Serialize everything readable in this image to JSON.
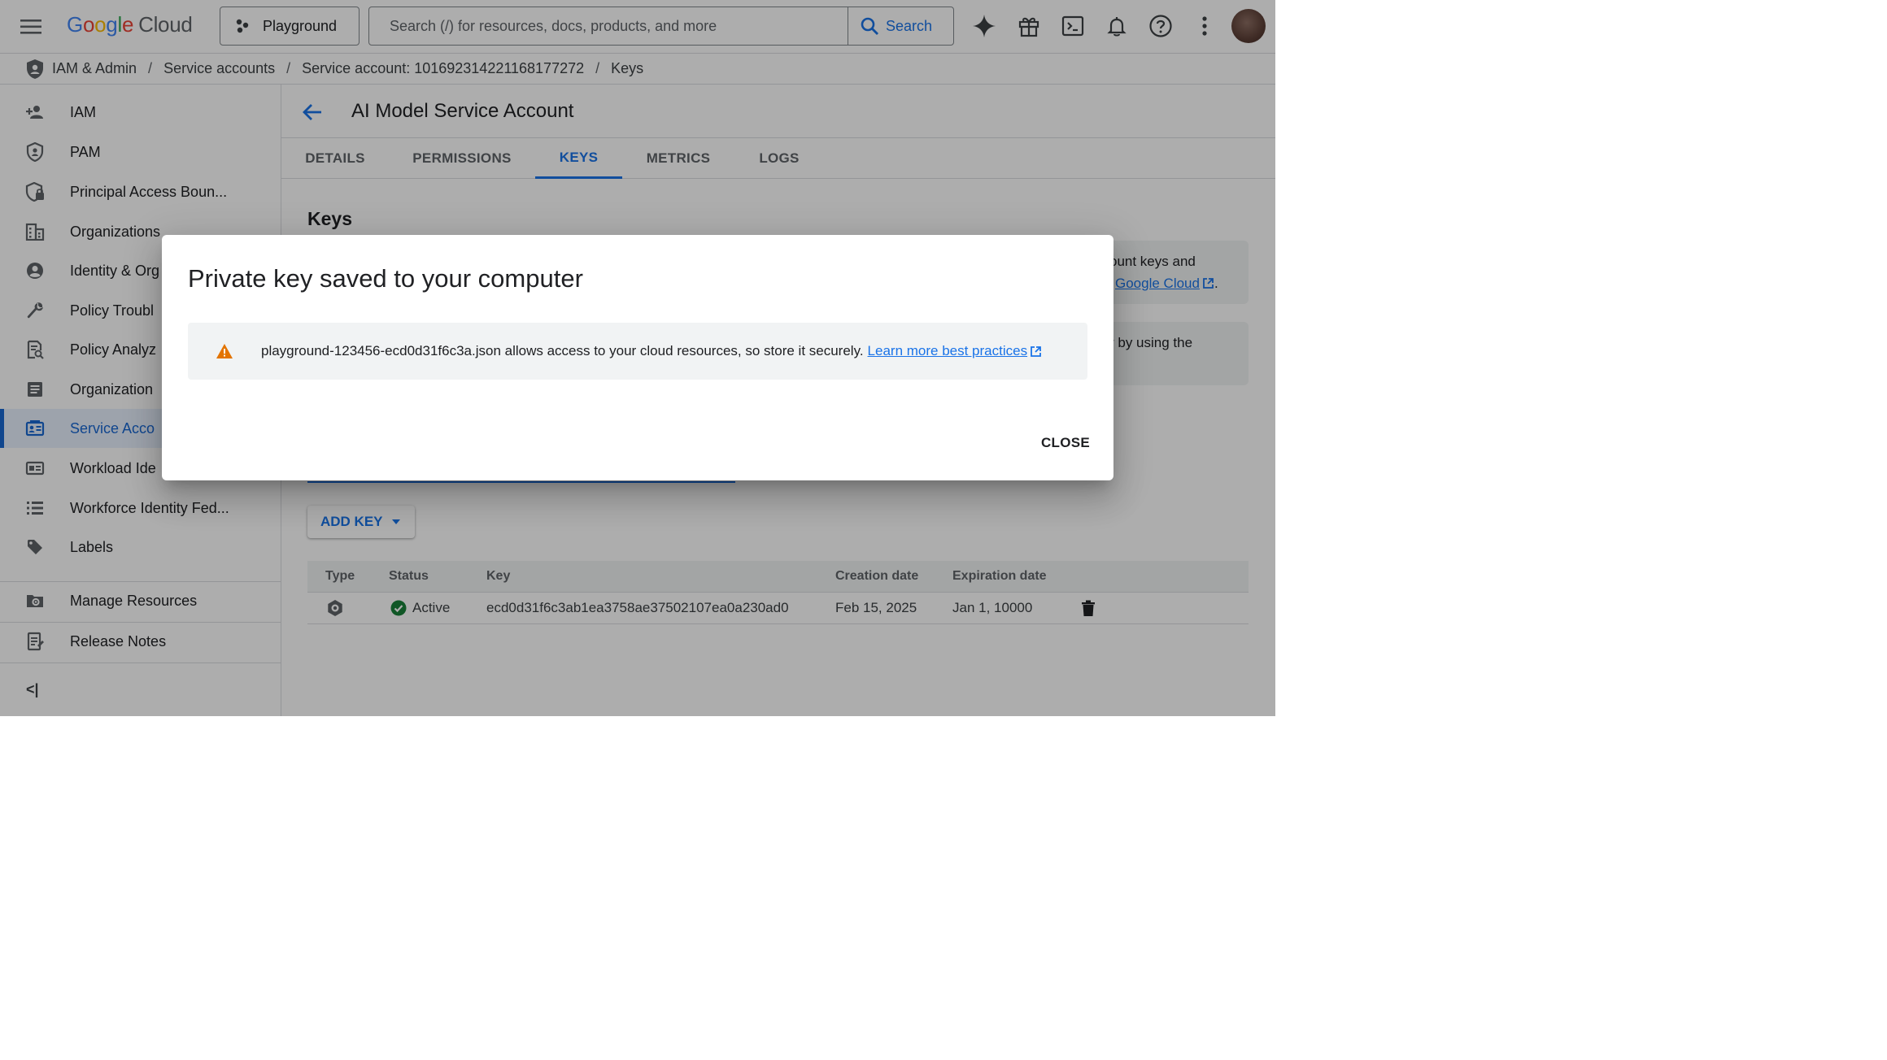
{
  "header": {
    "logo": {
      "g1": "G",
      "o1": "o",
      "o2": "o",
      "g2": "g",
      "l": "l",
      "e": "e",
      "product": "Cloud"
    },
    "project": "Playground",
    "search_placeholder": "Search (/) for resources, docs, products, and more",
    "search_button": "Search",
    "icons": [
      "hamburger-menu-icon",
      "gemini-sparkle-icon",
      "gift-icon",
      "cloud-shell-icon",
      "notifications-bell-icon",
      "help-icon",
      "more-vert-icon"
    ]
  },
  "breadcrumb": {
    "items": [
      "IAM & Admin",
      "Service accounts",
      "Service account: 101692314221168177272",
      "Keys"
    ],
    "separator": "/"
  },
  "sidebar": {
    "items": [
      {
        "label": "IAM",
        "icon": "person-add-icon"
      },
      {
        "label": "PAM",
        "icon": "shield-icon"
      },
      {
        "label": "Principal Access Boun...",
        "icon": "shield-lock-icon"
      },
      {
        "label": "Organizations",
        "icon": "building-icon"
      },
      {
        "label": "Identity & Org",
        "icon": "account-circle-icon"
      },
      {
        "label": "Policy Troubl",
        "icon": "wrench-icon"
      },
      {
        "label": "Policy Analyz",
        "icon": "policy-doc-icon"
      },
      {
        "label": "Organization",
        "icon": "article-icon"
      },
      {
        "label": "Service Acco",
        "icon": "service-account-icon",
        "active": true
      },
      {
        "label": "Workload Ide",
        "icon": "id-card-icon"
      },
      {
        "label": "Workforce Identity Fed...",
        "icon": "list-icon"
      },
      {
        "label": "Labels",
        "icon": "tag-icon"
      }
    ],
    "bottom": [
      {
        "label": "Manage Resources",
        "icon": "folder-settings-icon"
      },
      {
        "label": "Release Notes",
        "icon": "release-notes-icon"
      }
    ],
    "collapse": "<|"
  },
  "page": {
    "title": "AI Model Service Account",
    "tabs": [
      "DETAILS",
      "PERMISSIONS",
      "KEYS",
      "METRICS",
      "LOGS"
    ],
    "active_tab": "KEYS",
    "section_title": "Keys",
    "info1": {
      "text": "ount keys and",
      "link": "Google Cloud",
      "end": "."
    },
    "info2": {
      "text": "r by using the"
    },
    "add_key": "ADD KEY"
  },
  "table": {
    "columns": [
      "Type",
      "Status",
      "Key",
      "Creation date",
      "Expiration date"
    ],
    "rows": [
      {
        "type_icon": "key-type-icon",
        "status": "Active",
        "key": "ecd0d31f6c3ab1ea3758ae37502107ea0a230ad0",
        "created": "Feb 15, 2025",
        "expires": "Jan 1, 10000"
      }
    ]
  },
  "dialog": {
    "title": "Private key saved to your computer",
    "message": "playground-123456-ecd0d31f6c3a.json allows access to your cloud resources, so store it securely.",
    "link": "Learn more best practices",
    "close": "CLOSE"
  },
  "colors": {
    "accent": "#1a73e8",
    "warning": "#e37400",
    "success": "#188038",
    "scrim": "rgba(0,0,0,0.32)"
  }
}
